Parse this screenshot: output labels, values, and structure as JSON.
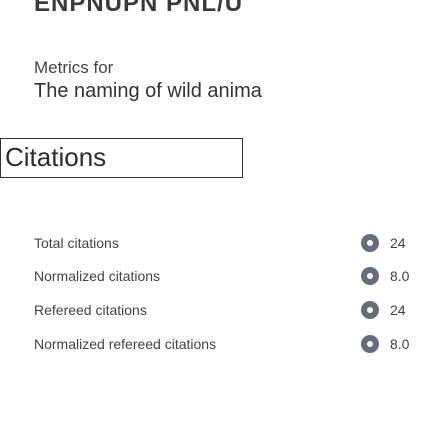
{
  "header": {
    "logo_text": "ENPNUPN PNL/U"
  },
  "metrics_section": {
    "label": "Metrics for",
    "article_title": "The naming of wild anima"
  },
  "citations": {
    "heading": "Citations",
    "rows": [
      {
        "label": "Total citations",
        "icon": "info-circle-icon",
        "value": "24"
      },
      {
        "label": "Normalized citations",
        "icon": "info-circle-icon",
        "value": "8.0"
      },
      {
        "label": "Refereed citations",
        "icon": "info-circle-icon",
        "value": "24"
      },
      {
        "label": "Normalized refereed citations",
        "icon": "info-circle-icon",
        "value": "8.0"
      }
    ]
  },
  "colors": {
    "icon": "#656d7a",
    "text": "#444444",
    "border": "#333333"
  }
}
